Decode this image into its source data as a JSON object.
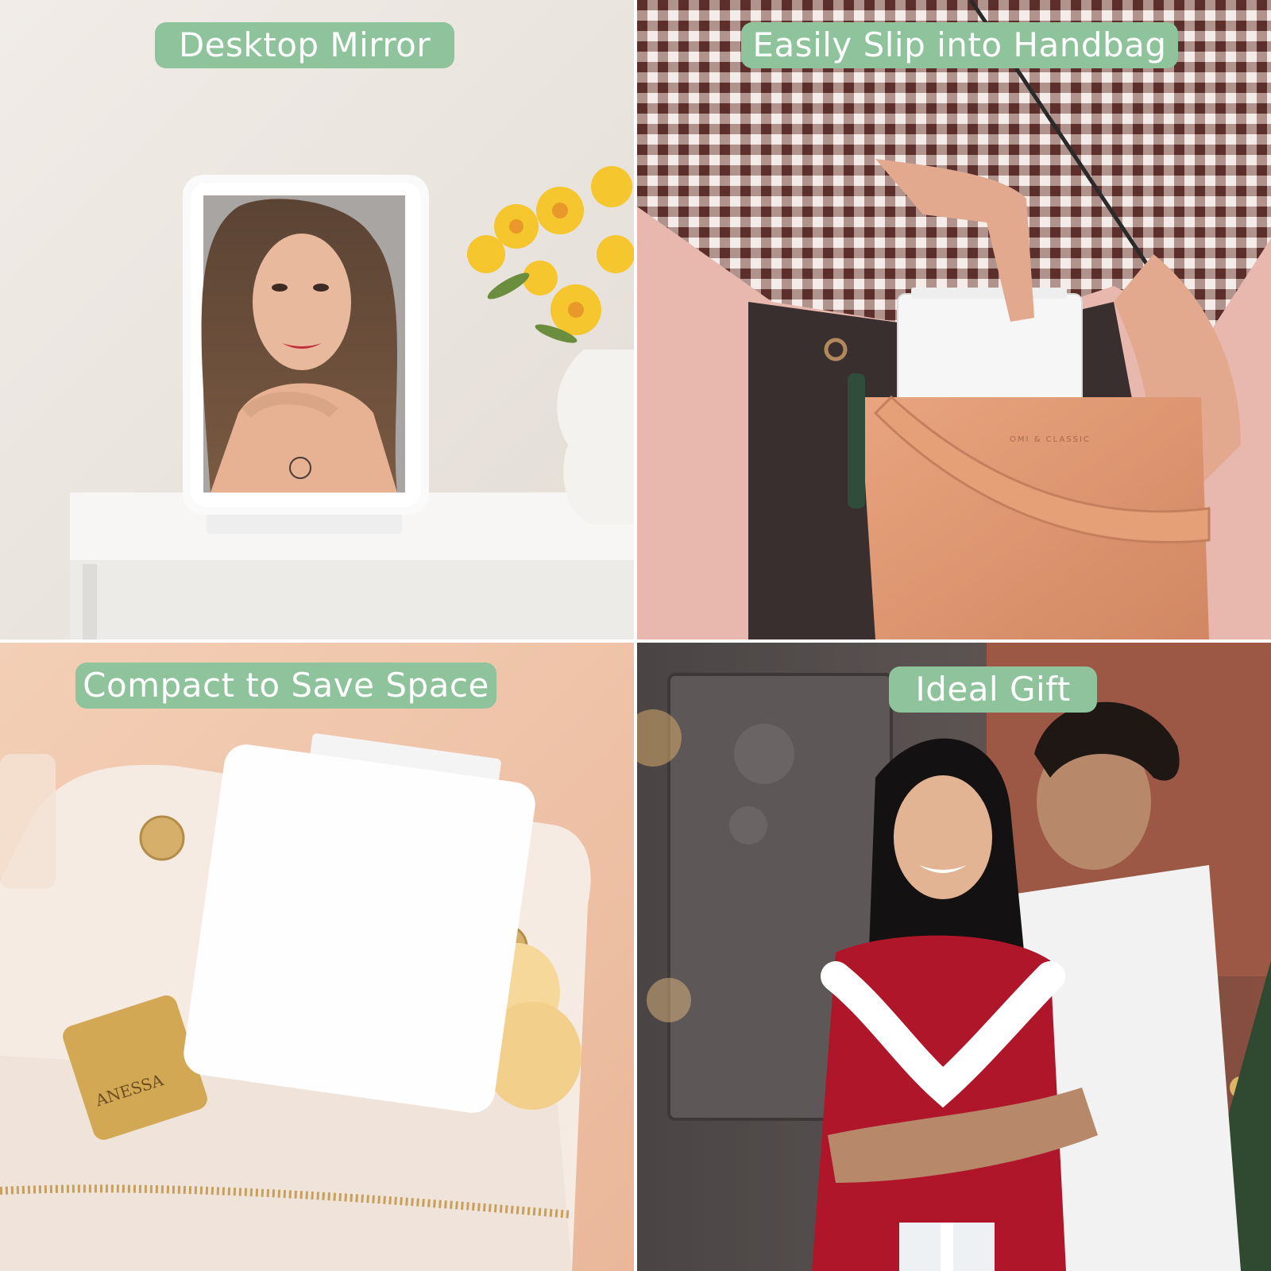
{
  "accent_color": "#8fc39b",
  "panels": [
    {
      "id": "desktop",
      "label": "Desktop Mirror"
    },
    {
      "id": "handbag",
      "label": "Easily Slip into Handbag",
      "bag_brand": "OMI & CLASSIC"
    },
    {
      "id": "compact",
      "label": "Compact to Save Space",
      "product_text": "ANESSA"
    },
    {
      "id": "gift",
      "label": "Ideal Gift"
    }
  ]
}
